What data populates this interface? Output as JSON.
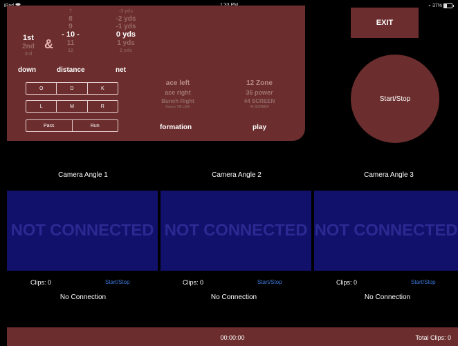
{
  "status_bar": {
    "device": "iPad",
    "wifi_icon": "wifi-icon",
    "time": "1:33 PM",
    "battery": "37%",
    "battery_level": 0.37
  },
  "down_picker": {
    "rows": [
      "",
      "",
      "1st",
      "2nd",
      "3rd"
    ],
    "label": "down"
  },
  "distance_picker": {
    "rows": [
      "7",
      "8",
      "9",
      "- 10 -",
      "11",
      "12"
    ],
    "label": "distance",
    "amp": "&"
  },
  "net_picker": {
    "rows": [
      "-3 yds",
      "-2 yds",
      "-1 yds",
      "0 yds",
      "1 yds",
      "2 yds"
    ],
    "label": "net"
  },
  "hash_buttons": [
    "O",
    "D",
    "K"
  ],
  "position_buttons": [
    "L",
    "M",
    "R"
  ],
  "type_buttons": [
    "Pass",
    "Run"
  ],
  "formation_picker": {
    "rows": [
      "ace left",
      "ace right",
      "Bunch Right",
      "Deuce VB LMA"
    ],
    "label": "formation"
  },
  "play_picker": {
    "rows": [
      "12 Zone",
      "36 power",
      "44 SCREEN",
      "46 SCREEN"
    ],
    "label": "play"
  },
  "exit_label": "EXIT",
  "start_stop_label": "Start/Stop",
  "cameras": [
    {
      "title": "Camera Angle 1",
      "status": "NOT CONNECTED",
      "clips": "Clips: 0",
      "start_stop": "Start/Stop",
      "connection": "No Connection"
    },
    {
      "title": "Camera Angle 2",
      "status": "NOT CONNECTED",
      "clips": "Clips: 0",
      "start_stop": "Start/Stop",
      "connection": "No Connection"
    },
    {
      "title": "Camera Angle 3",
      "status": "NOT CONNECTED",
      "clips": "Clips: 0",
      "start_stop": "Start/Stop",
      "connection": "No Connection"
    }
  ],
  "footer": {
    "timer": "00:00:00",
    "total_clips": "Total Clips: 0"
  },
  "colors": {
    "panel": "#6b2d2d",
    "camera_bg": "#11106a",
    "not_connected_text": "#2a2a92",
    "link": "#3a78d8"
  }
}
